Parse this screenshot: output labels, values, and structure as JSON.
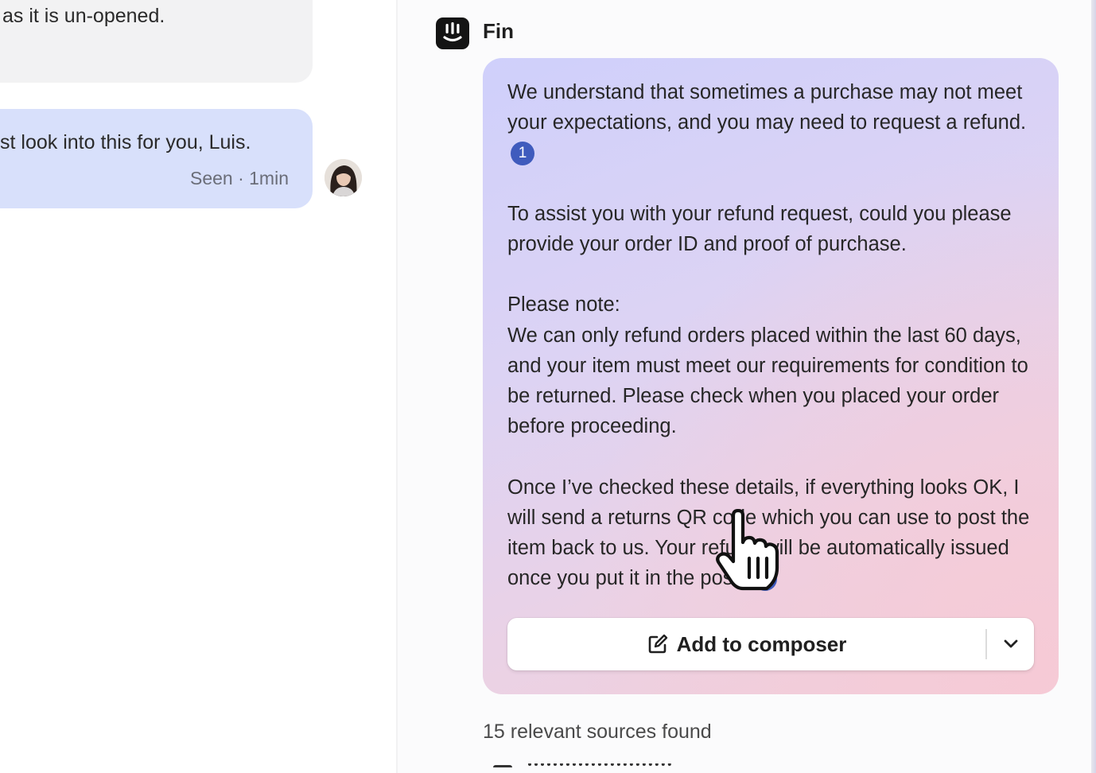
{
  "conversation": {
    "customer_message_partial": "as it is un-opened.",
    "agent_message_partial": "st look into this for you, Luis.",
    "agent_message_meta": "Seen · 1min"
  },
  "fin": {
    "name": "Fin",
    "answer_paragraphs": [
      {
        "text": "We understand that sometimes a purchase may not meet your expectations, and you may need to request a refund.",
        "citation": "1"
      },
      {
        "text": "To assist you with your refund request, could you please provide your order ID and proof of purchase.",
        "citation": ""
      },
      {
        "text": "Please note:",
        "citation": ""
      },
      {
        "text": "We can only refund orders placed within the last 60 days, and your item must meet our requirements for condition to be returned. Please check when you placed your order before proceeding.",
        "citation": ""
      },
      {
        "text": "Once I’ve checked these details, if everything looks OK, I will send a returns QR code which you can use to post the item back to us. Your refund will be automatically issued once you put it in the post.",
        "citation": "2"
      }
    ],
    "add_to_composer_label": "Add to composer",
    "sources_found": "15 relevant sources found"
  },
  "icons": {
    "logo": "fin-logo-icon",
    "composer": "edit-icon",
    "dropdown": "chevron-down-icon",
    "cursor": "hand-pointer-icon"
  },
  "colors": {
    "citation_badge": "#3f5bbd",
    "agent_bubble": "#d8e0fb",
    "customer_bubble": "#f2f2f3",
    "answer_gradient_start": "#cfd0fb",
    "answer_gradient_end": "#f1cfd9"
  }
}
